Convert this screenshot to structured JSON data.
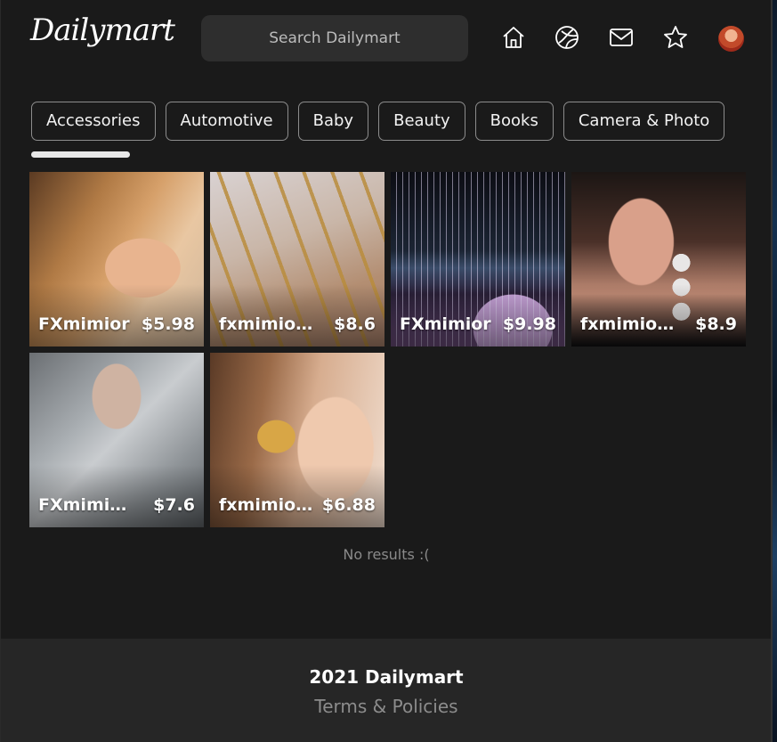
{
  "header": {
    "logo": "Dailymart",
    "search_placeholder": "Search Dailymart",
    "icons": [
      "home-icon",
      "explore-icon",
      "mail-icon",
      "star-icon",
      "avatar"
    ]
  },
  "categories": [
    "Accessories",
    "Automotive",
    "Baby",
    "Beauty",
    "Books",
    "Camera & Photo"
  ],
  "products": [
    {
      "name": "FXmimior",
      "price": "$5.98",
      "image": "ear-cuff-earring"
    },
    {
      "name": "fxmimior Women",
      "price": "$8.6",
      "image": "gold-bracelets"
    },
    {
      "name": "FXmimior",
      "price": "$9.98",
      "image": "crystal-tassel-earring"
    },
    {
      "name": "fxmimior Women",
      "price": "$8.9",
      "image": "disc-drop-earrings"
    },
    {
      "name": "FXmimior Layered",
      "price": "$7.6",
      "image": "layered-necklace"
    },
    {
      "name": "fxmimior Butterfly",
      "price": "$6.88",
      "image": "butterfly-earring"
    }
  ],
  "status": "No results :(",
  "footer": {
    "copyright": "2021 Dailymart",
    "links": "Terms & Policies"
  },
  "colors": {
    "background": "#1a1a1a",
    "search_bg": "#2e2e2e",
    "footer_bg": "#262626",
    "chip_border": "#8c8c8c"
  }
}
